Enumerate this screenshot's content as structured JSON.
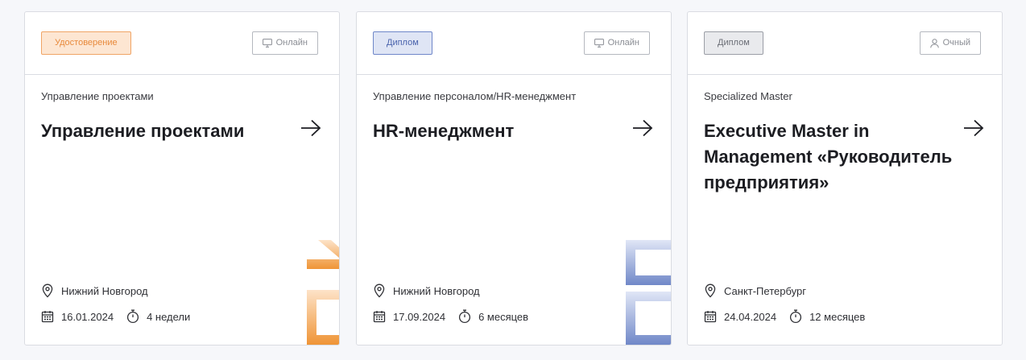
{
  "cards": [
    {
      "badge": "Удостоверение",
      "badge_color": "#f0a465",
      "format": "Онлайн",
      "format_icon": "monitor-icon",
      "category": "Управление проектами",
      "title": "Управление проектами",
      "location": "Нижний Новгород",
      "start_date": "16.01.2024",
      "duration": "4 недели"
    },
    {
      "badge": "Диплом",
      "badge_color": "#6f87c9",
      "format": "Онлайн",
      "format_icon": "monitor-icon",
      "category": "Управление персоналом/HR-менеджмент",
      "title": "HR-менеджмент",
      "location": "Нижний Новгород",
      "start_date": "17.09.2024",
      "duration": "6 месяцев"
    },
    {
      "badge": "Диплом",
      "badge_color": "#9b9ea6",
      "format": "Очный",
      "format_icon": "person-icon",
      "category": "Specialized Master",
      "title": "Executive Master in Management «Руководитель предприятия»",
      "location": "Санкт-Петербург",
      "start_date": "24.04.2024",
      "duration": "12 месяцев"
    }
  ]
}
